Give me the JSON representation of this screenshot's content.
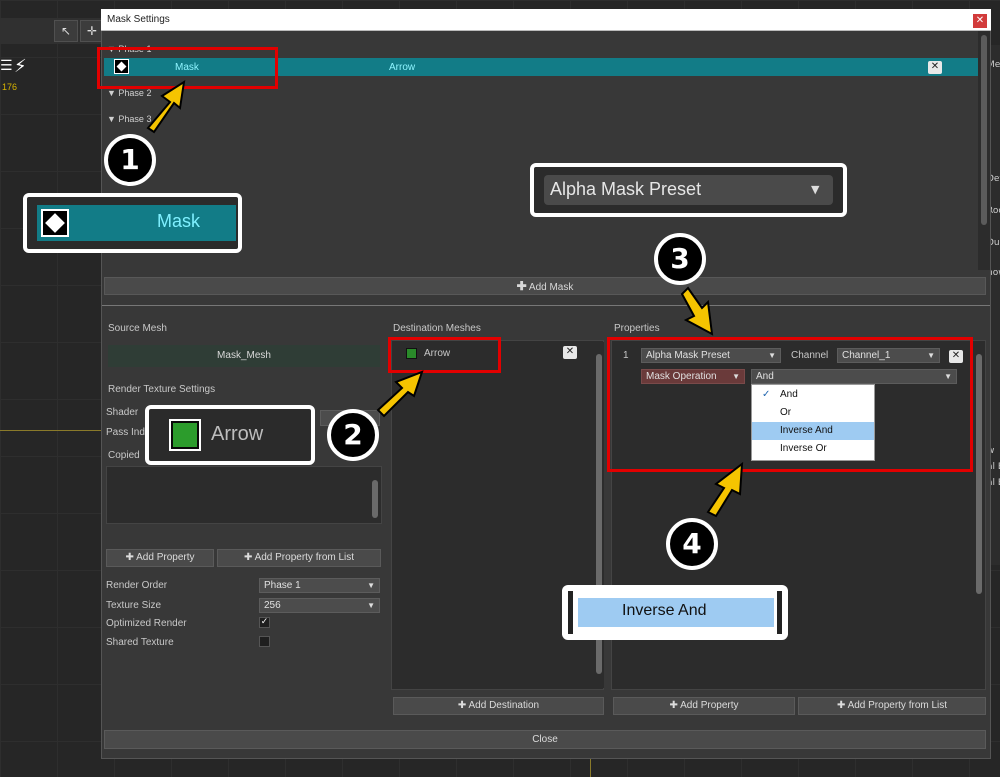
{
  "background": {
    "toolbar_icons": [
      "cursor-icon",
      "move-icon"
    ],
    "counter": "176",
    "right_strip_labels": [
      "Me",
      "Det",
      "Roo",
      "Dup",
      "now",
      "w",
      "al E",
      "al E"
    ]
  },
  "dialog": {
    "title": "Mask Settings",
    "phases": [
      {
        "label": "Phase 1"
      },
      {
        "label": "Phase 2"
      },
      {
        "label": "Phase 3"
      }
    ],
    "mask_row": {
      "name": "Mask",
      "destination": "Arrow"
    },
    "add_mask_label": "Add Mask",
    "source_mesh": {
      "title": "Source Mesh",
      "value": "Mask_Mesh"
    },
    "render_texture": {
      "title": "Render Texture Settings",
      "shader_label": "Shader",
      "pass_label": "Pass Ind",
      "copied_label": "Copied",
      "add_property": "Add Property",
      "add_property_from_list": "Add Property from List",
      "render_order_label": "Render Order",
      "render_order_value": "Phase 1",
      "texture_size_label": "Texture Size",
      "texture_size_value": "256",
      "optimized_label": "Optimized Render",
      "optimized_checked": true,
      "shared_label": "Shared Texture",
      "shared_checked": false
    },
    "destination": {
      "title": "Destination Meshes",
      "items": [
        {
          "name": "Arrow"
        }
      ],
      "add_button": "Add Destination"
    },
    "properties": {
      "title": "Properties",
      "row_index": "1",
      "preset_value": "Alpha Mask Preset",
      "channel_label": "Channel",
      "channel_value": "Channel_1",
      "mask_operation_label": "Mask Operation",
      "mask_operation_value": "And",
      "menu_options": [
        "And",
        "Or",
        "Inverse And",
        "Inverse Or"
      ],
      "menu_selected": "And",
      "menu_highlighted": "Inverse And",
      "add_property": "Add Property",
      "add_property_from_list": "Add Property from List"
    },
    "close_label": "Close"
  },
  "callouts": {
    "mask_zoom": "Mask",
    "preset_zoom": "Alpha Mask Preset",
    "arrow_zoom": "Arrow",
    "inverse_zoom": "Inverse And",
    "numbers": [
      "1",
      "2",
      "3",
      "4"
    ]
  },
  "colors": {
    "highlight_teal": "#127c87",
    "mask_text": "#8ff4ff",
    "annotation_red": "#e20000",
    "arrow_yellow": "#f5c400",
    "menu_highlight": "#9ecbf2"
  }
}
